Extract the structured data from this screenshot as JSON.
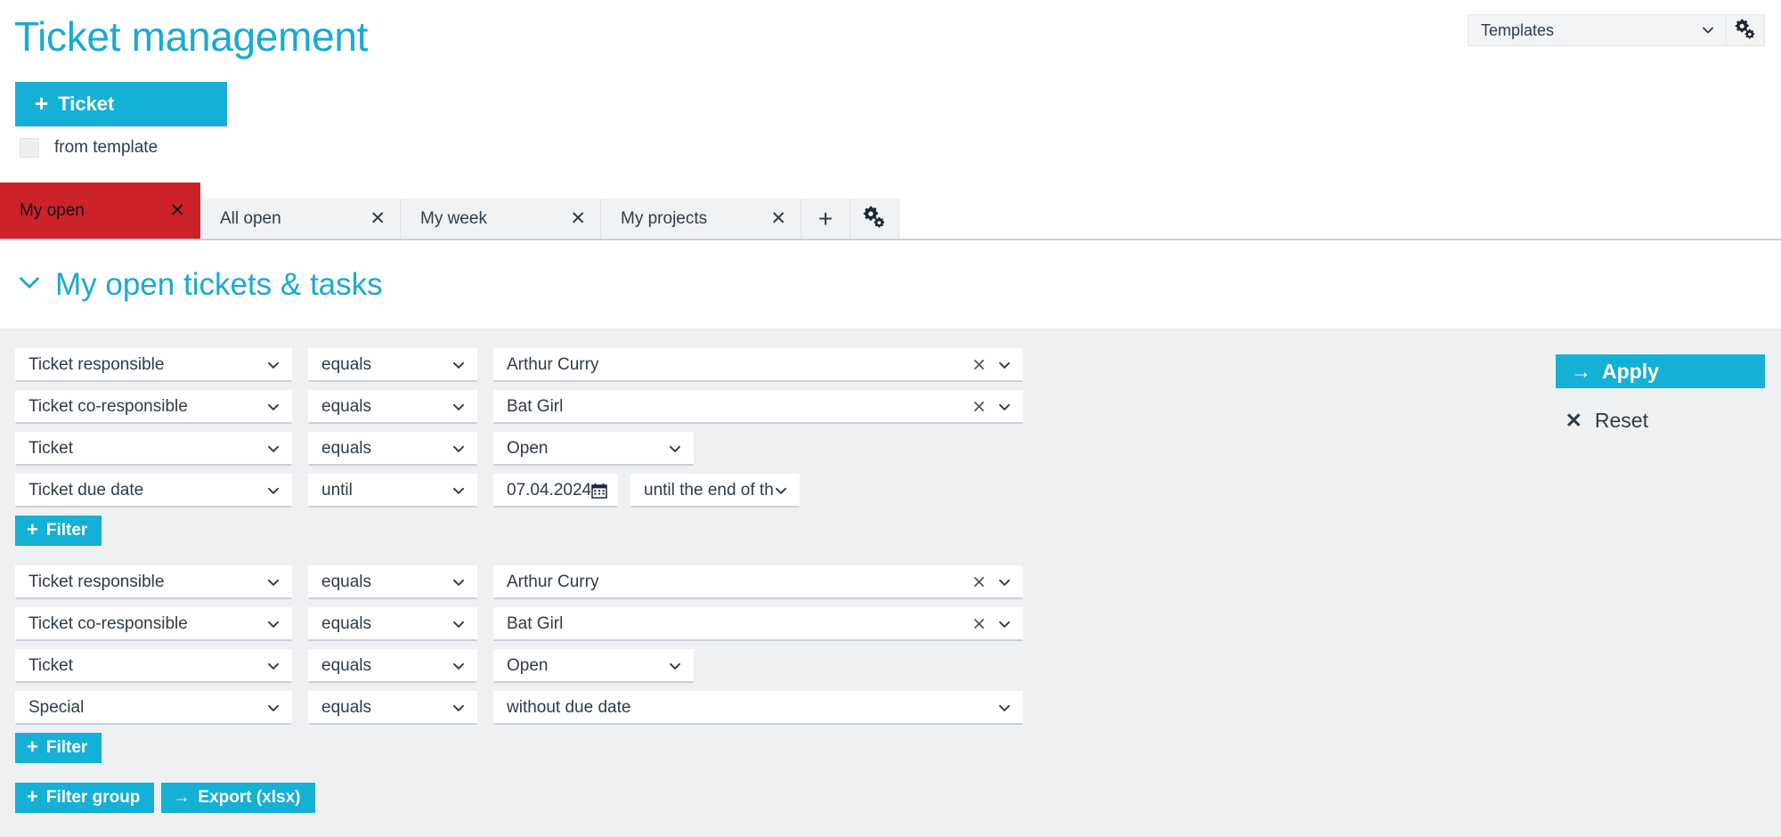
{
  "header": {
    "title": "Ticket management",
    "new_ticket_label": "Ticket",
    "new_ticket_plus": "+",
    "from_template_label": "from template",
    "templates_selected": "Templates",
    "templates_gear_icon": "double-gear-icon",
    "templates_chevron_icon": "chevron-down-icon"
  },
  "tabs": {
    "items": [
      {
        "label": "My open",
        "close": "✕",
        "active": true
      },
      {
        "label": "All open",
        "close": "✕",
        "active": false
      },
      {
        "label": "My week",
        "close": "✕",
        "active": false
      },
      {
        "label": "My projects",
        "close": "✕",
        "active": false
      }
    ],
    "add_label": "+",
    "settings_icon": "double-gear-icon"
  },
  "section": {
    "title": "My open tickets & tasks",
    "collapse_icon": "chevron-down-icon"
  },
  "filters": {
    "groups": [
      {
        "rows": [
          {
            "field": "Ticket responsible",
            "operator": "equals",
            "value": "Arthur Curry",
            "value_kind": "tokenfield",
            "clear_icon": "✕",
            "chevron_icon": "chevron-down-icon"
          },
          {
            "field": "Ticket co-responsible",
            "operator": "equals",
            "value": "Bat Girl",
            "value_kind": "tokenfield",
            "clear_icon": "✕",
            "chevron_icon": "chevron-down-icon"
          },
          {
            "field": "Ticket",
            "operator": "equals",
            "value": "Open",
            "value_kind": "select",
            "chevron_icon": "chevron-down-icon"
          },
          {
            "field": "Ticket due date",
            "operator": "until",
            "value": "07.04.2024",
            "value_kind": "date",
            "date_icon": "calendar-icon",
            "relative": "until the end of the w",
            "chevron_icon": "chevron-down-icon"
          }
        ],
        "add_filter_label": "Filter",
        "add_filter_plus": "+"
      },
      {
        "rows": [
          {
            "field": "Ticket responsible",
            "operator": "equals",
            "value": "Arthur Curry",
            "value_kind": "tokenfield",
            "clear_icon": "✕",
            "chevron_icon": "chevron-down-icon"
          },
          {
            "field": "Ticket co-responsible",
            "operator": "equals",
            "value": "Bat Girl",
            "value_kind": "tokenfield",
            "clear_icon": "✕",
            "chevron_icon": "chevron-down-icon"
          },
          {
            "field": "Ticket",
            "operator": "equals",
            "value": "Open",
            "value_kind": "select",
            "chevron_icon": "chevron-down-icon"
          },
          {
            "field": "Special",
            "operator": "equals",
            "value": "without due date",
            "value_kind": "select-wide",
            "chevron_icon": "chevron-down-icon"
          }
        ],
        "add_filter_label": "Filter",
        "add_filter_plus": "+"
      }
    ],
    "add_filter_group_label": "Filter group",
    "add_filter_group_plus": "+",
    "export_label": "Export (xlsx)",
    "export_arrow": "→",
    "apply_label": "Apply",
    "apply_arrow": "→",
    "reset_label": "Reset",
    "reset_icon": "✕"
  },
  "colors": {
    "accent": "#14b0d5",
    "title": "#19aad1",
    "active_tab": "#cc2229",
    "panel_bg": "#eff0f2",
    "text": "#2e3c47"
  }
}
